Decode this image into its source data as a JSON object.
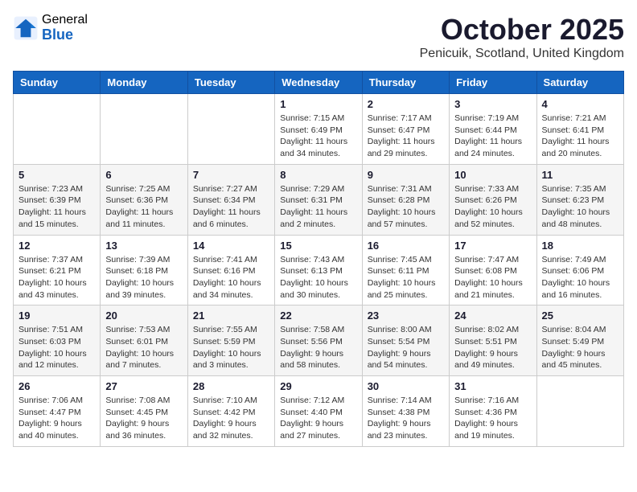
{
  "header": {
    "logo_general": "General",
    "logo_blue": "Blue",
    "month_year": "October 2025",
    "location": "Penicuik, Scotland, United Kingdom"
  },
  "weekdays": [
    "Sunday",
    "Monday",
    "Tuesday",
    "Wednesday",
    "Thursday",
    "Friday",
    "Saturday"
  ],
  "weeks": [
    [
      {
        "date": "",
        "info": ""
      },
      {
        "date": "",
        "info": ""
      },
      {
        "date": "",
        "info": ""
      },
      {
        "date": "1",
        "info": "Sunrise: 7:15 AM\nSunset: 6:49 PM\nDaylight: 11 hours\nand 34 minutes."
      },
      {
        "date": "2",
        "info": "Sunrise: 7:17 AM\nSunset: 6:47 PM\nDaylight: 11 hours\nand 29 minutes."
      },
      {
        "date": "3",
        "info": "Sunrise: 7:19 AM\nSunset: 6:44 PM\nDaylight: 11 hours\nand 24 minutes."
      },
      {
        "date": "4",
        "info": "Sunrise: 7:21 AM\nSunset: 6:41 PM\nDaylight: 11 hours\nand 20 minutes."
      }
    ],
    [
      {
        "date": "5",
        "info": "Sunrise: 7:23 AM\nSunset: 6:39 PM\nDaylight: 11 hours\nand 15 minutes."
      },
      {
        "date": "6",
        "info": "Sunrise: 7:25 AM\nSunset: 6:36 PM\nDaylight: 11 hours\nand 11 minutes."
      },
      {
        "date": "7",
        "info": "Sunrise: 7:27 AM\nSunset: 6:34 PM\nDaylight: 11 hours\nand 6 minutes."
      },
      {
        "date": "8",
        "info": "Sunrise: 7:29 AM\nSunset: 6:31 PM\nDaylight: 11 hours\nand 2 minutes."
      },
      {
        "date": "9",
        "info": "Sunrise: 7:31 AM\nSunset: 6:28 PM\nDaylight: 10 hours\nand 57 minutes."
      },
      {
        "date": "10",
        "info": "Sunrise: 7:33 AM\nSunset: 6:26 PM\nDaylight: 10 hours\nand 52 minutes."
      },
      {
        "date": "11",
        "info": "Sunrise: 7:35 AM\nSunset: 6:23 PM\nDaylight: 10 hours\nand 48 minutes."
      }
    ],
    [
      {
        "date": "12",
        "info": "Sunrise: 7:37 AM\nSunset: 6:21 PM\nDaylight: 10 hours\nand 43 minutes."
      },
      {
        "date": "13",
        "info": "Sunrise: 7:39 AM\nSunset: 6:18 PM\nDaylight: 10 hours\nand 39 minutes."
      },
      {
        "date": "14",
        "info": "Sunrise: 7:41 AM\nSunset: 6:16 PM\nDaylight: 10 hours\nand 34 minutes."
      },
      {
        "date": "15",
        "info": "Sunrise: 7:43 AM\nSunset: 6:13 PM\nDaylight: 10 hours\nand 30 minutes."
      },
      {
        "date": "16",
        "info": "Sunrise: 7:45 AM\nSunset: 6:11 PM\nDaylight: 10 hours\nand 25 minutes."
      },
      {
        "date": "17",
        "info": "Sunrise: 7:47 AM\nSunset: 6:08 PM\nDaylight: 10 hours\nand 21 minutes."
      },
      {
        "date": "18",
        "info": "Sunrise: 7:49 AM\nSunset: 6:06 PM\nDaylight: 10 hours\nand 16 minutes."
      }
    ],
    [
      {
        "date": "19",
        "info": "Sunrise: 7:51 AM\nSunset: 6:03 PM\nDaylight: 10 hours\nand 12 minutes."
      },
      {
        "date": "20",
        "info": "Sunrise: 7:53 AM\nSunset: 6:01 PM\nDaylight: 10 hours\nand 7 minutes."
      },
      {
        "date": "21",
        "info": "Sunrise: 7:55 AM\nSunset: 5:59 PM\nDaylight: 10 hours\nand 3 minutes."
      },
      {
        "date": "22",
        "info": "Sunrise: 7:58 AM\nSunset: 5:56 PM\nDaylight: 9 hours\nand 58 minutes."
      },
      {
        "date": "23",
        "info": "Sunrise: 8:00 AM\nSunset: 5:54 PM\nDaylight: 9 hours\nand 54 minutes."
      },
      {
        "date": "24",
        "info": "Sunrise: 8:02 AM\nSunset: 5:51 PM\nDaylight: 9 hours\nand 49 minutes."
      },
      {
        "date": "25",
        "info": "Sunrise: 8:04 AM\nSunset: 5:49 PM\nDaylight: 9 hours\nand 45 minutes."
      }
    ],
    [
      {
        "date": "26",
        "info": "Sunrise: 7:06 AM\nSunset: 4:47 PM\nDaylight: 9 hours\nand 40 minutes."
      },
      {
        "date": "27",
        "info": "Sunrise: 7:08 AM\nSunset: 4:45 PM\nDaylight: 9 hours\nand 36 minutes."
      },
      {
        "date": "28",
        "info": "Sunrise: 7:10 AM\nSunset: 4:42 PM\nDaylight: 9 hours\nand 32 minutes."
      },
      {
        "date": "29",
        "info": "Sunrise: 7:12 AM\nSunset: 4:40 PM\nDaylight: 9 hours\nand 27 minutes."
      },
      {
        "date": "30",
        "info": "Sunrise: 7:14 AM\nSunset: 4:38 PM\nDaylight: 9 hours\nand 23 minutes."
      },
      {
        "date": "31",
        "info": "Sunrise: 7:16 AM\nSunset: 4:36 PM\nDaylight: 9 hours\nand 19 minutes."
      },
      {
        "date": "",
        "info": ""
      }
    ]
  ]
}
